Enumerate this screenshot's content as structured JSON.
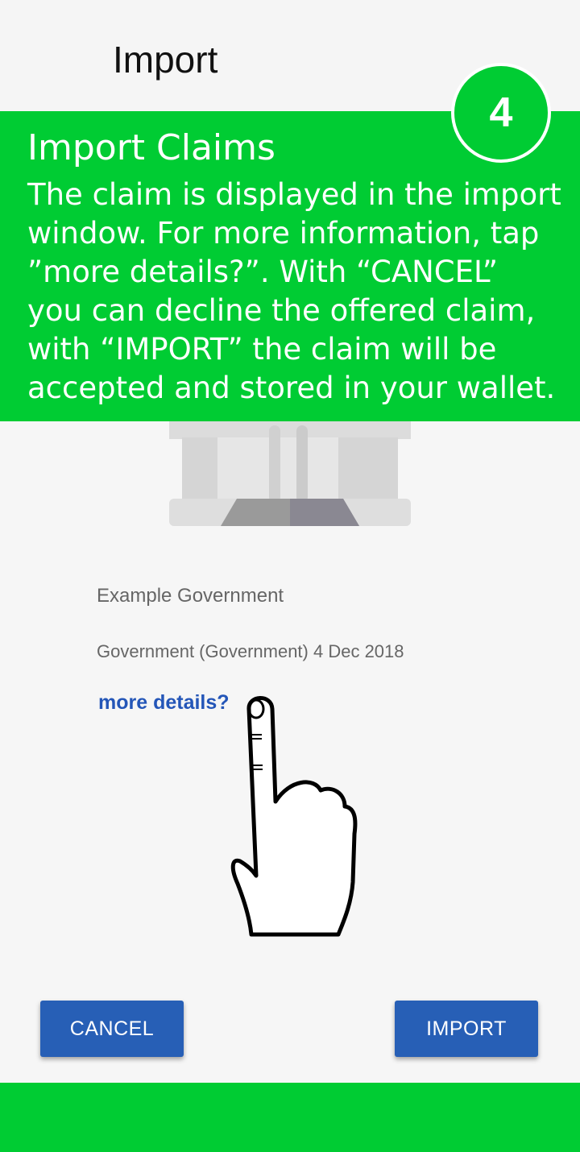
{
  "app_bar": {
    "title": "Import"
  },
  "tutorial": {
    "step_number": "4",
    "title": "Import Claims",
    "body_lines": [
      "The claim is displayed in the import",
      "window. For more information, tap",
      "”more details?”. With “CANCEL”",
      "you can decline the offered claim,",
      "with “IMPORT” the claim will be",
      "accepted and stored in your wallet."
    ],
    "accent_color": "#00cc33"
  },
  "claim": {
    "issuer": "Example Government",
    "meta": "Government (Government) 4 Dec 2018",
    "more_details_label": "more details?",
    "illustration_icon": "government-building-icon"
  },
  "pointer_icon": "pointing-hand-icon",
  "actions": {
    "cancel_label": "CANCEL",
    "import_label": "IMPORT",
    "button_color": "#275fb6"
  }
}
